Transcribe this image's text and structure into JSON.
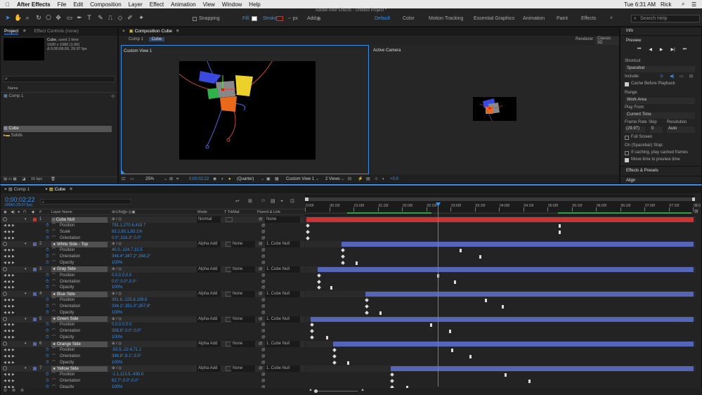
{
  "menubar": {
    "apple": "",
    "app": "After Effects",
    "items": [
      "File",
      "Edit",
      "Composition",
      "Layer",
      "Effect",
      "Animation",
      "View",
      "Window",
      "Help"
    ],
    "time": "Tue 6:31 AM",
    "user": "Rick"
  },
  "window_title": "Adobe After Effects - Untitled Project *",
  "toolbar": {
    "snapping": "Snapping",
    "fill": "Fill:",
    "stroke": "Stroke:",
    "px": "-- px",
    "add": "Add:",
    "workspaces": [
      "Default",
      "Color",
      "Motion Tracking",
      "Essential Graphics",
      "Animation",
      "Paint",
      "Effects"
    ],
    "search_placeholder": "Search Help"
  },
  "project": {
    "tab": "Project",
    "effect_controls": "Effect Controls (none)",
    "item_name": "Cube",
    "item_used": ", used 1 time",
    "item_info": "1920 x 1080 (1.00)",
    "item_duration": "Δ 0;00;08;00, 29.97 fps",
    "column_name": "Name",
    "items": [
      "Comp 1",
      "Cube",
      "Solids"
    ],
    "bpc": "16 bpc"
  },
  "composition": {
    "tab": "Composition Cube",
    "breadcrumbs": [
      "Comp 1",
      "Cube"
    ],
    "renderer_label": "Renderer:",
    "renderer": "Classic 3D",
    "view_left": "Custom View 1",
    "view_right": "Active Camera",
    "zoom": "25%",
    "timecode": "0;00;02;22",
    "resolution": "(Quarter)",
    "view_select": "Custom View 1",
    "views": "2 Views",
    "exposure": "+0.0"
  },
  "right_panel": {
    "info": "Info",
    "preview": "Preview",
    "shortcut_label": "Shortcut",
    "shortcut": "Spacebar",
    "include": "Include:",
    "cache": "Cache Before Playback",
    "range_label": "Range",
    "range": "Work Area",
    "play_from_label": "Play From",
    "play_from": "Current Time",
    "frame_rate_label": "Frame Rate",
    "skip_label": "Skip",
    "resolution_label": "Resolution",
    "frame_rate": "(29.97)",
    "skip": "0",
    "resolution": "Auto",
    "full_screen": "Full Screen",
    "on_stop": "On (Spacebar) Stop:",
    "if_caching": "If caching, play cached frames",
    "move_time": "Move time to preview time",
    "effects_presets": "Effects & Presets",
    "align": "Align"
  },
  "timeline": {
    "tabs": [
      "Comp 1",
      "Cube"
    ],
    "timecode": "0;00;02;22",
    "fps": "00082 (29.97 fps)",
    "headers": {
      "layer_name": "Layer Name",
      "mode": "Mode",
      "trkmat": "T TrkMat",
      "parent": "Parent & Link"
    },
    "ruler": [
      "0:00f",
      "00:15f",
      "01:00f",
      "01:15f",
      "02:00f",
      "02:15f",
      "03:00f",
      "03:15f",
      "04:00f",
      "04:15f",
      "05:00f",
      "05:15f",
      "06:00f",
      "06:15f",
      "07:00f",
      "07:15f",
      "08:0"
    ],
    "rows": [
      {
        "type": "layer",
        "num": "1",
        "name": "Cube Null",
        "mode": "Normal",
        "trk": "",
        "parent": "None",
        "color": "#cc3333"
      },
      {
        "type": "prop",
        "name": "Position",
        "value": "791.1,270.6,419.7"
      },
      {
        "type": "prop",
        "name": "Scale",
        "value": "83.1,83.1,83.1%"
      },
      {
        "type": "prop",
        "name": "Orientation",
        "value": "0.0°,316.3°,0.0°"
      },
      {
        "type": "layer",
        "num": "2",
        "name": "White Side - Top",
        "mode": "Alpha Add",
        "trk": "None",
        "parent": "1. Cube Null",
        "color": "#5566b8"
      },
      {
        "type": "prop",
        "name": "Position",
        "value": "40.0,-124.7,32.5"
      },
      {
        "type": "prop",
        "name": "Orientation",
        "value": "344.4°,347.2°,358.2°"
      },
      {
        "type": "prop",
        "name": "Opacity",
        "value": "100%"
      },
      {
        "type": "layer",
        "num": "3",
        "name": "Gray Side",
        "mode": "Alpha Add",
        "trk": "None",
        "parent": "1. Cube Null",
        "color": "#5566b8"
      },
      {
        "type": "prop",
        "name": "Position",
        "value": "0.0,0.0,0.0"
      },
      {
        "type": "prop",
        "name": "Orientation",
        "value": "0.0°,0.0°,0.0°"
      },
      {
        "type": "prop",
        "name": "Opacity",
        "value": "100%"
      },
      {
        "type": "layer",
        "num": "4",
        "name": "Blue Side",
        "mode": "Alpha Add",
        "trk": "None",
        "parent": "1. Cube Null",
        "color": "#5566b8"
      },
      {
        "type": "prop",
        "name": "Position",
        "value": "391.6,-225.8,109.8"
      },
      {
        "type": "prop",
        "name": "Orientation",
        "value": "334.1°,351.0°,357.9°"
      },
      {
        "type": "prop",
        "name": "Opacity",
        "value": "100%"
      },
      {
        "type": "layer",
        "num": "5",
        "name": "Green Side",
        "mode": "Alpha Add",
        "trk": "None",
        "parent": "1. Cube Null",
        "color": "#5566b8"
      },
      {
        "type": "prop",
        "name": "Position",
        "value": "0.0,0.0,0.0"
      },
      {
        "type": "prop",
        "name": "Orientation",
        "value": "358.8°,0.0°,0.0°"
      },
      {
        "type": "prop",
        "name": "Opacity",
        "value": "100%"
      },
      {
        "type": "layer",
        "num": "6",
        "name": "Orange Side",
        "mode": "Alpha Add",
        "trk": "None",
        "parent": "1. Cube Null",
        "color": "#5566b8"
      },
      {
        "type": "prop",
        "name": "Position",
        "value": "-50.5,-22.4,71.1"
      },
      {
        "type": "prop",
        "name": "Orientation",
        "value": "348.8°,8.1°,3.5°"
      },
      {
        "type": "prop",
        "name": "Opacity",
        "value": "100%"
      },
      {
        "type": "layer",
        "num": "7",
        "name": "Yellow Side",
        "mode": "Alpha Add",
        "trk": "None",
        "parent": "1. Cube Null",
        "color": "#5566b8"
      },
      {
        "type": "prop",
        "name": "Position",
        "value": "-1.1,113.5,-430.0"
      },
      {
        "type": "prop",
        "name": "Orientation",
        "value": "62.7°,0.0°,0.0°"
      },
      {
        "type": "prop",
        "name": "Opacity",
        "value": "100%"
      }
    ]
  }
}
